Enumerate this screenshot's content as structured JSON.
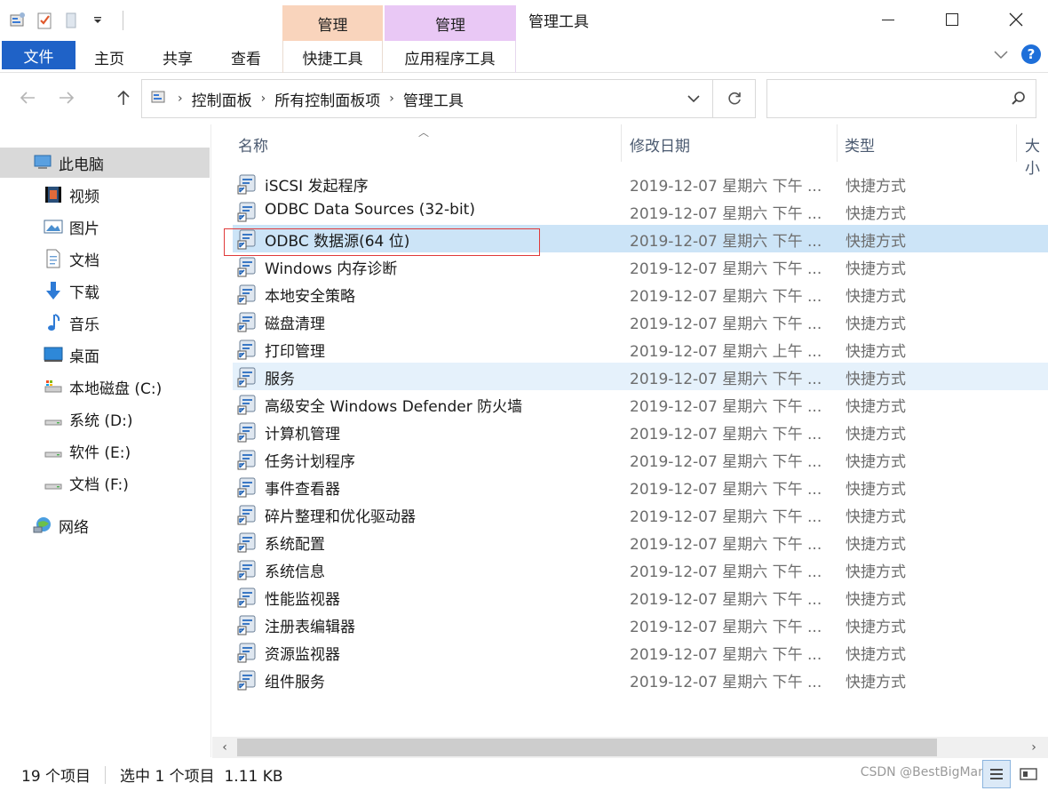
{
  "window": {
    "title": "管理工具",
    "context_tab_shortcut": "管理",
    "context_tab_app": "管理"
  },
  "ribbon": {
    "tabs": [
      "文件",
      "主页",
      "共享",
      "查看",
      "快捷工具",
      "应用程序工具"
    ]
  },
  "address": {
    "breadcrumbs": [
      "控制面板",
      "所有控制面板项",
      "管理工具"
    ]
  },
  "search": {
    "placeholder": ""
  },
  "sidebar": {
    "items": [
      {
        "label": "此电脑",
        "icon": "computer-icon"
      },
      {
        "label": "视频",
        "icon": "video-icon"
      },
      {
        "label": "图片",
        "icon": "picture-icon"
      },
      {
        "label": "文档",
        "icon": "document-icon"
      },
      {
        "label": "下载",
        "icon": "download-icon"
      },
      {
        "label": "音乐",
        "icon": "music-icon"
      },
      {
        "label": "桌面",
        "icon": "desktop-icon"
      },
      {
        "label": "本地磁盘 (C:)",
        "icon": "drive-icon"
      },
      {
        "label": "系统 (D:)",
        "icon": "drive-icon"
      },
      {
        "label": "软件 (E:)",
        "icon": "drive-icon"
      },
      {
        "label": "文档 (F:)",
        "icon": "drive-icon"
      },
      {
        "label": "网络",
        "icon": "network-icon"
      }
    ]
  },
  "columns": [
    "名称",
    "修改日期",
    "类型",
    "大小"
  ],
  "files": [
    {
      "name": "iSCSI 发起程序",
      "date": "2019-12-07 星期六 下午 ...",
      "type": "快捷方式"
    },
    {
      "name": "ODBC Data Sources (32-bit)",
      "date": "2019-12-07 星期六 下午 ...",
      "type": "快捷方式"
    },
    {
      "name": "ODBC 数据源(64 位)",
      "date": "2019-12-07 星期六 下午 ...",
      "type": "快捷方式"
    },
    {
      "name": "Windows 内存诊断",
      "date": "2019-12-07 星期六 下午 ...",
      "type": "快捷方式"
    },
    {
      "name": "本地安全策略",
      "date": "2019-12-07 星期六 下午 ...",
      "type": "快捷方式"
    },
    {
      "name": "磁盘清理",
      "date": "2019-12-07 星期六 下午 ...",
      "type": "快捷方式"
    },
    {
      "name": "打印管理",
      "date": "2019-12-07 星期六 上午 ...",
      "type": "快捷方式"
    },
    {
      "name": "服务",
      "date": "2019-12-07 星期六 下午 ...",
      "type": "快捷方式"
    },
    {
      "name": "高级安全 Windows Defender 防火墙",
      "date": "2019-12-07 星期六 下午 ...",
      "type": "快捷方式"
    },
    {
      "name": "计算机管理",
      "date": "2019-12-07 星期六 下午 ...",
      "type": "快捷方式"
    },
    {
      "name": "任务计划程序",
      "date": "2019-12-07 星期六 下午 ...",
      "type": "快捷方式"
    },
    {
      "name": "事件查看器",
      "date": "2019-12-07 星期六 下午 ...",
      "type": "快捷方式"
    },
    {
      "name": "碎片整理和优化驱动器",
      "date": "2019-12-07 星期六 下午 ...",
      "type": "快捷方式"
    },
    {
      "name": "系统配置",
      "date": "2019-12-07 星期六 下午 ...",
      "type": "快捷方式"
    },
    {
      "name": "系统信息",
      "date": "2019-12-07 星期六 下午 ...",
      "type": "快捷方式"
    },
    {
      "name": "性能监视器",
      "date": "2019-12-07 星期六 下午 ...",
      "type": "快捷方式"
    },
    {
      "name": "注册表编辑器",
      "date": "2019-12-07 星期六 下午 ...",
      "type": "快捷方式"
    },
    {
      "name": "资源监视器",
      "date": "2019-12-07 星期六 下午 ...",
      "type": "快捷方式"
    },
    {
      "name": "组件服务",
      "date": "2019-12-07 星期六 下午 ...",
      "type": "快捷方式"
    }
  ],
  "selected_index": 2,
  "hover_index": 7,
  "status": {
    "count": "19 个项目",
    "selection": "选中 1 个项目  1.11 KB",
    "watermark": "CSDN @BestBigMan"
  },
  "colors": {
    "file_tab": "#1f62c7",
    "selected_row": "#cce4f7",
    "hover_row": "#e5f1fb",
    "highlight_box": "#e03a3a"
  }
}
